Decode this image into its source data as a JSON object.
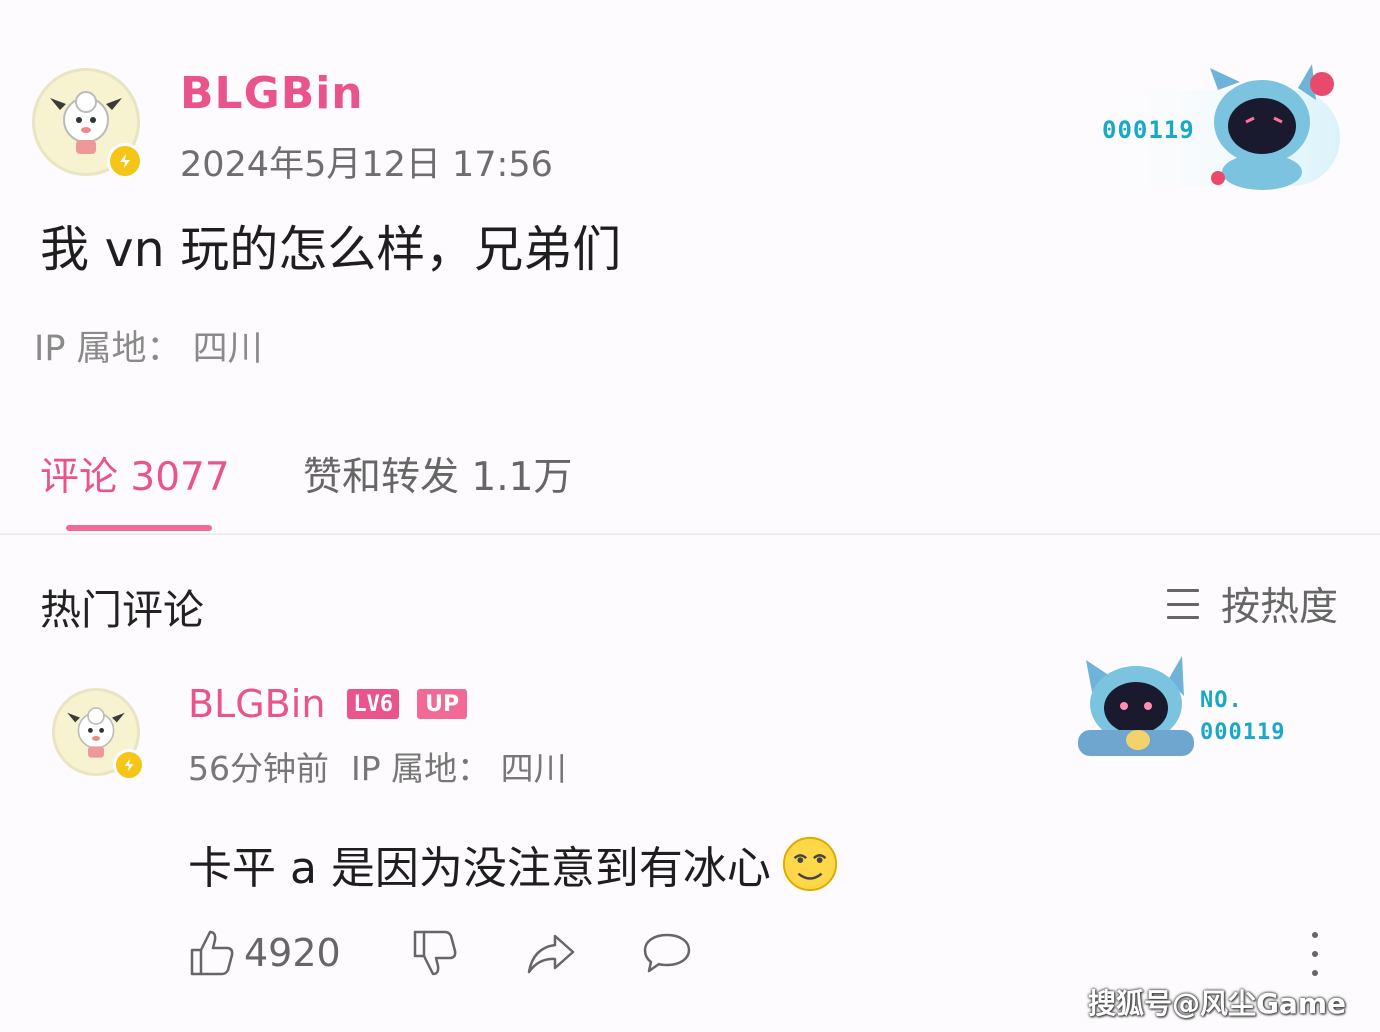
{
  "post": {
    "author": "BLGBin",
    "timestamp": "2024年5月12日 17:56",
    "content": "我 vn 玩的怎么样，兄弟们",
    "ip_location": "IP 属地： 四川",
    "fan_card_number": "000119"
  },
  "tabs": {
    "comments_label": "评论 3077",
    "likes_label": "赞和转发 1.1万"
  },
  "hot_comments": {
    "title": "热门评论",
    "sort_label": "按热度"
  },
  "comment": {
    "author": "BLGBin",
    "level_badge": "LV6",
    "up_badge": "UP",
    "time": "56分钟前",
    "ip_location": "IP 属地： 四川",
    "text": "卡平 a 是因为没注意到有冰心",
    "emoji": "smirk-emoji",
    "fan_card_no": "NO.",
    "fan_card_number": "000119",
    "like_count": "4920"
  },
  "watermark": "搜狐号@风尘Game",
  "colors": {
    "accent_pink": "#e8548b",
    "fan_card_cyan": "#1aa8c9",
    "verify_yellow": "#f5c518"
  },
  "icons": [
    "verified-badge-icon",
    "sort-lines-icon",
    "thumbs-up-icon",
    "thumbs-down-icon",
    "share-icon",
    "comment-bubble-icon",
    "more-dots-icon"
  ]
}
